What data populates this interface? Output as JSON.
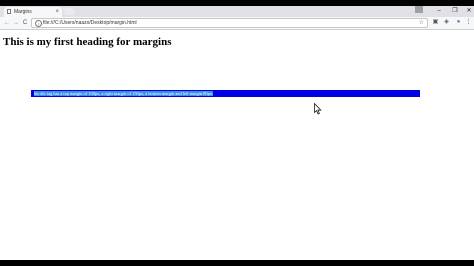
{
  "browser": {
    "tab_title": "Margins",
    "tab_close": "×",
    "window_min": "–",
    "window_max": "❐",
    "window_close": "✕",
    "nav_back": "←",
    "nav_forward": "→",
    "nav_reload": "C",
    "address_info": "i",
    "url": "file:///C:/Users/naazo/Desktop/margin.html",
    "star": "☆",
    "menu": "⋮"
  },
  "page": {
    "heading": "This is my first heading for margins",
    "div_text": "his div tag has a top margin of 100px, a right margin of 150px, a bottom margin and left margin 80px."
  },
  "colors": {
    "div_background": "#0000e6",
    "selection": "#3d8ee6"
  }
}
